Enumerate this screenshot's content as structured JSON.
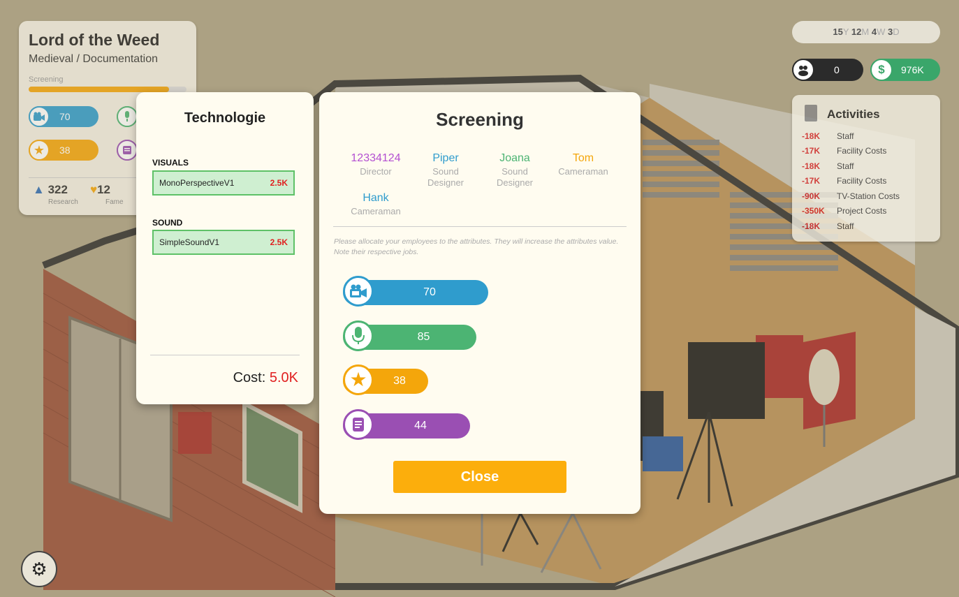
{
  "colors": {
    "visuals": "#2f9ccd",
    "sound": "#4cb473",
    "star": "#f4a60b",
    "book": "#9a4fb3",
    "money": "#3aa66a",
    "negative": "#d52020",
    "accent": "#fcae0c"
  },
  "project": {
    "title": "Lord of the Weed",
    "genre": "Medieval / Documentation",
    "phase_label": "Screening",
    "phase_progress": 0.89,
    "mini_attributes": [
      {
        "icon": "camera-icon",
        "value": "70"
      },
      {
        "icon": "microphone-icon",
        "value": ""
      },
      {
        "icon": "star-icon",
        "value": "38"
      },
      {
        "icon": "book-icon",
        "value": ""
      }
    ],
    "research_value": "322",
    "research_label": "Research",
    "fame_value": "12",
    "fame_label": "Fame"
  },
  "hud": {
    "date": {
      "years": "15",
      "y": "Y",
      "months": "12",
      "m": "M",
      "weeks": "4",
      "w": "W",
      "days": "3",
      "d": "D"
    },
    "fans": "0",
    "money": "976K",
    "money_icon": "$"
  },
  "activities": {
    "title": "Activities",
    "rows": [
      {
        "amount": "-18K",
        "label": "Staff"
      },
      {
        "amount": "-17K",
        "label": "Facility Costs"
      },
      {
        "amount": "-18K",
        "label": "Staff"
      },
      {
        "amount": "-17K",
        "label": "Facility Costs"
      },
      {
        "amount": "-90K",
        "label": "TV-Station Costs"
      },
      {
        "amount": "-350K",
        "label": "Project Costs"
      },
      {
        "amount": "-18K",
        "label": "Staff"
      }
    ]
  },
  "technologie": {
    "title": "Technologie",
    "categories": [
      {
        "label": "VISUALS",
        "item": "MonoPerspectiveV1",
        "price": "2.5K"
      },
      {
        "label": "SOUND",
        "item": "SimpleSoundV1",
        "price": "2.5K"
      }
    ],
    "cost_label": "Cost:",
    "cost_value": "5.0K"
  },
  "screening": {
    "title": "Screening",
    "employees": [
      {
        "name": "12334124",
        "job": "Director",
        "color": "#b34fd1"
      },
      {
        "name": "Piper",
        "job": "Sound Designer",
        "color": "#2f9ccd"
      },
      {
        "name": "Joana",
        "job": "Sound Designer",
        "color": "#4cb473"
      },
      {
        "name": "Tom",
        "job": "Cameraman",
        "color": "#f4a60b"
      },
      {
        "name": "Hank",
        "job": "Cameraman",
        "color": "#2f9ccd"
      }
    ],
    "hint": "Please allocate your employees to the attributes. They will increase the attributes value. Note their respective jobs.",
    "attributes": [
      {
        "icon": "camera-icon",
        "value": "70",
        "color": "#2f9ccd"
      },
      {
        "icon": "microphone-icon",
        "value": "85",
        "color": "#4cb473"
      },
      {
        "icon": "star-icon",
        "value": "38",
        "color": "#f4a60b"
      },
      {
        "icon": "book-icon",
        "value": "44",
        "color": "#9a4fb3"
      }
    ],
    "close_label": "Close"
  }
}
